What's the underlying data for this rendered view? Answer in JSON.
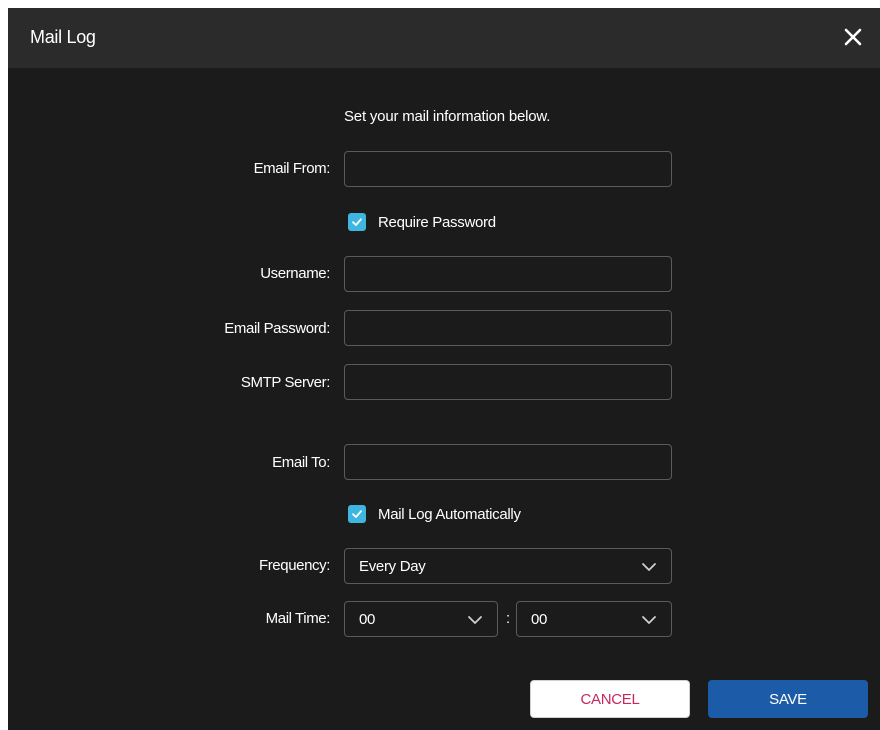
{
  "dialog": {
    "title": "Mail Log",
    "close_icon": "close-icon"
  },
  "form": {
    "subtitle": "Set your mail information below.",
    "email_from": {
      "label": "Email From:",
      "value": ""
    },
    "require_password": {
      "label": "Require Password",
      "checked": true
    },
    "username": {
      "label": "Username:",
      "value": ""
    },
    "email_password": {
      "label": "Email Password:",
      "value": ""
    },
    "smtp_server": {
      "label": "SMTP Server:",
      "value": ""
    },
    "email_to": {
      "label": "Email To:",
      "value": ""
    },
    "mail_log_automatically": {
      "label": "Mail Log Automatically",
      "checked": true
    },
    "frequency": {
      "label": "Frequency:",
      "value": "Every Day"
    },
    "mail_time": {
      "label": "Mail Time:",
      "hour": "00",
      "separator": ":",
      "minute": "00"
    }
  },
  "buttons": {
    "cancel_label": "CANCEL",
    "save_label": "SAVE"
  },
  "colors": {
    "dialog_bg": "#1b1b1b",
    "titlebar_bg": "#2b2b2b",
    "checkbox_accent": "#3fb6e0",
    "save_button": "#1b5ba8",
    "cancel_text": "#c6285f"
  }
}
